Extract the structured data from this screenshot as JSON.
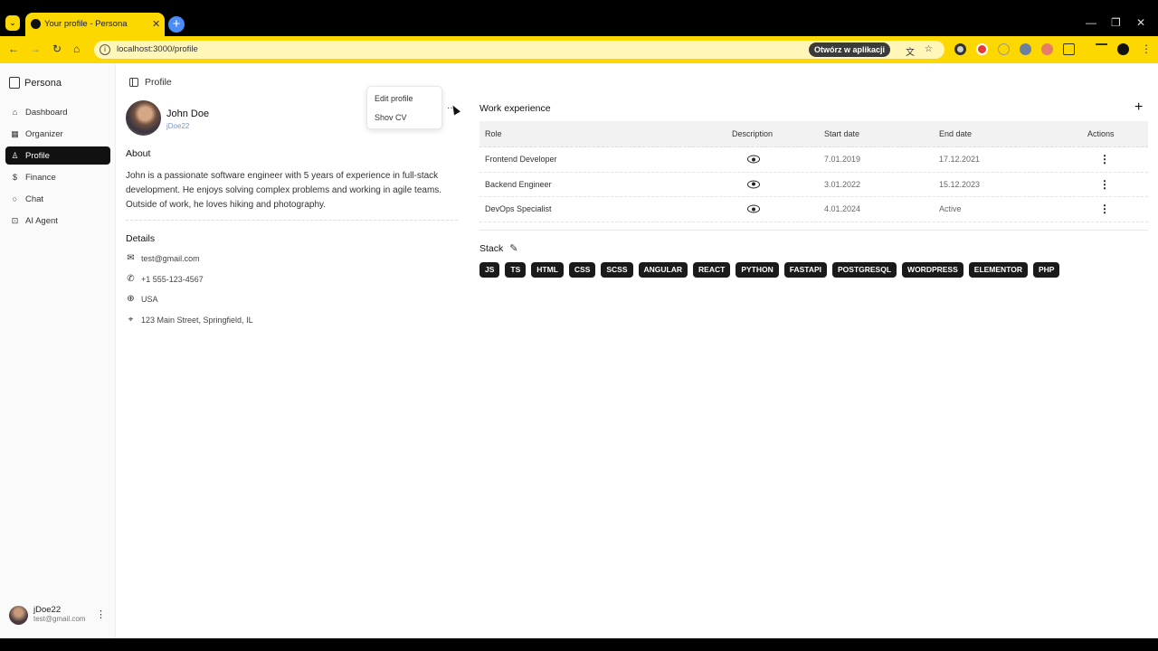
{
  "browser": {
    "tab_title": "Your profile - Persona",
    "url": "localhost:3000/profile",
    "open_in_app": "Otwórz w aplikacji"
  },
  "sidebar": {
    "brand": "Persona",
    "items": [
      {
        "label": "Dashboard",
        "icon": "home-icon"
      },
      {
        "label": "Organizer",
        "icon": "calendar-icon"
      },
      {
        "label": "Profile",
        "icon": "user-icon"
      },
      {
        "label": "Finance",
        "icon": "dollar-icon"
      },
      {
        "label": "Chat",
        "icon": "chat-icon"
      },
      {
        "label": "AI Agent",
        "icon": "bot-icon"
      }
    ],
    "active_index": 2,
    "footer": {
      "username": "jDoe22",
      "email": "test@gmail.com"
    }
  },
  "header": {
    "title": "Profile"
  },
  "profile": {
    "name": "John Doe",
    "username": "jDoe22",
    "menu": {
      "edit": "Edit profile",
      "show_cv": "Shov CV"
    },
    "about_title": "About",
    "about_text": "John is a passionate software engineer with 5 years of experience in full-stack development. He enjoys solving complex problems and working in agile teams. Outside of work, he loves hiking and photography.",
    "details_title": "Details",
    "details": {
      "email": "test@gmail.com",
      "phone": "+1 555-123-4567",
      "country": "USA",
      "address": "123 Main Street, Springfield, IL"
    }
  },
  "work": {
    "title": "Work experience",
    "columns": [
      "Role",
      "Description",
      "Start date",
      "End date",
      "Actions"
    ],
    "rows": [
      {
        "role": "Frontend Developer",
        "start": "7.01.2019",
        "end": "17.12.2021"
      },
      {
        "role": "Backend Engineer",
        "start": "3.01.2022",
        "end": "15.12.2023"
      },
      {
        "role": "DevOps Specialist",
        "start": "4.01.2024",
        "end": "Active"
      }
    ]
  },
  "stack": {
    "title": "Stack",
    "tags": [
      "JS",
      "TS",
      "HTML",
      "CSS",
      "SCSS",
      "ANGULAR",
      "REACT",
      "PYTHON",
      "FASTAPI",
      "POSTGRESQL",
      "WORDPRESS",
      "ELEMENTOR",
      "PHP"
    ]
  },
  "colors": {
    "browser_accent": "#fdd700",
    "active_nav": "#111111",
    "tag_bg": "#1a1a1a"
  }
}
